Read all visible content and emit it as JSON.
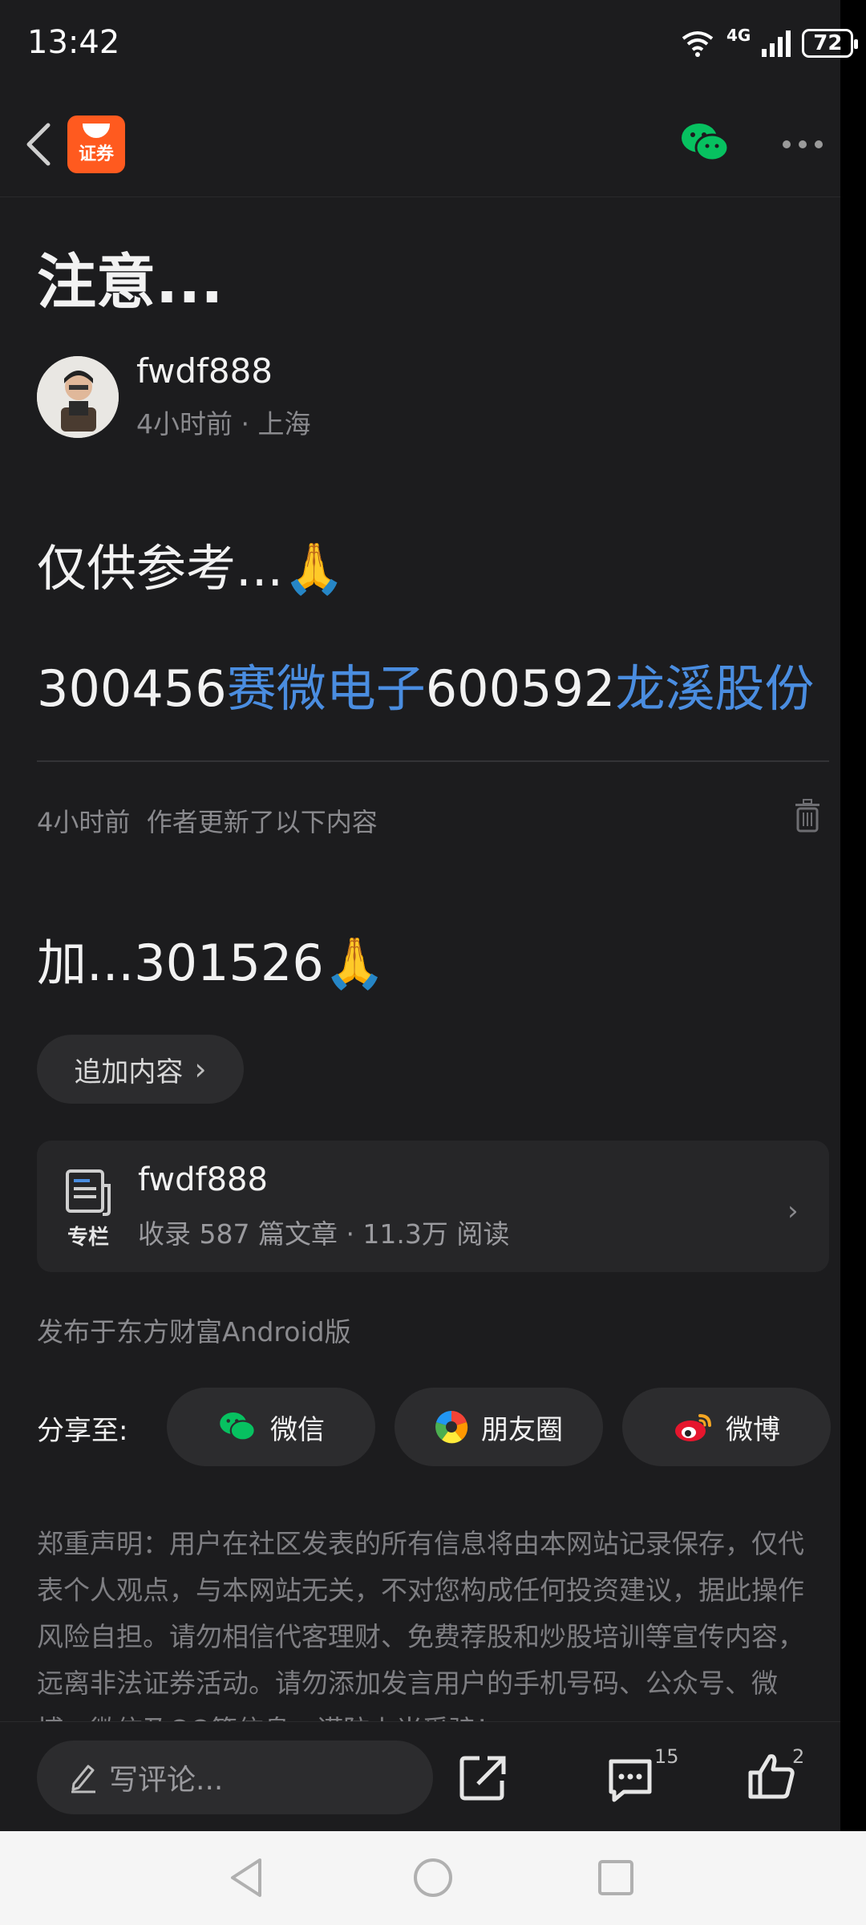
{
  "status_bar": {
    "time": "13:42",
    "network": "4G",
    "battery": "72"
  },
  "navbar": {
    "app_logo_text": "证券"
  },
  "article": {
    "title": "注意...",
    "author": "fwdf888",
    "time_ago": "4小时前",
    "location": "上海",
    "meta_sep": "·",
    "line1_text": "仅供参考...",
    "line1_emoji": "🙏",
    "line2": [
      {
        "text": "300456",
        "link": false
      },
      {
        "text": "赛微电子",
        "link": true
      },
      {
        "text": "600592",
        "link": false
      },
      {
        "text": "龙溪股份",
        "link": true
      }
    ],
    "update_time": "4小时前",
    "update_text": "作者更新了以下内容",
    "line3_text": "加...301526",
    "line3_emoji": "🙏",
    "append_label": "追加内容",
    "append_chevron": "›"
  },
  "column_card": {
    "icon_label": "专栏",
    "name": "fwdf888",
    "stats": "收录 587 篇文章 · 11.3万 阅读",
    "chevron": "›"
  },
  "published_on": "发布于东方财富Android版",
  "share": {
    "label": "分享至:",
    "buttons": [
      {
        "label": "微信",
        "icon": "wechat-icon"
      },
      {
        "label": "朋友圈",
        "icon": "moments-icon"
      },
      {
        "label": "微博",
        "icon": "weibo-icon"
      }
    ]
  },
  "disclaimer": "郑重声明：用户在社区发表的所有信息将由本网站记录保存，仅代表个人观点，与本网站无关，不对您构成任何投资建议，据此操作风险自担。请勿相信代客理财、免费荐股和炒股培训等宣传内容，远离非法证券活动。请勿添加发言用户的手机号码、公众号、微博、微信及QQ等信息，谨防上当受骗！",
  "bottom_bar": {
    "comment_placeholder": "写评论...",
    "comment_count": "15",
    "like_count": "2"
  },
  "colors": {
    "background": "#1c1c1e",
    "link": "#4a8de0",
    "brand": "#ff5a1f",
    "wechat": "#07c160"
  }
}
